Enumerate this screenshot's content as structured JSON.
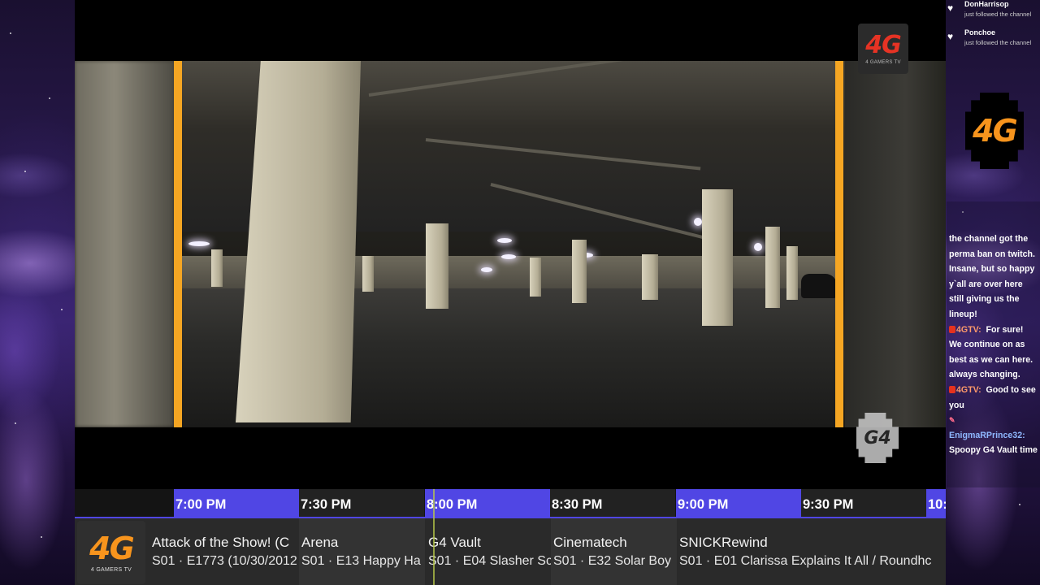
{
  "brand": {
    "mark": "4G",
    "tagline": "4 GAMERS TV",
    "network_bug": "G4",
    "accent_orange": "#f7941d",
    "accent_red": "#e63324",
    "timeline_highlight": "#5046e4"
  },
  "chat": {
    "follows": [
      {
        "name": "DonHarrisop",
        "action": "just followed the channel"
      },
      {
        "name": "Ponchoe",
        "action": "just followed the channel"
      }
    ],
    "messages": [
      {
        "user": "",
        "text": "the channel got the perma ban on twitch. Insane, but so happy y`all are over here still giving us the lineup!"
      },
      {
        "user": "4GTV:",
        "text": "For sure! We continue on as best as we can here. always changing."
      },
      {
        "user": "4GTV:",
        "text": "Good to see you"
      },
      {
        "user": "EnigmaRPrince32:",
        "text": "Spoopy G4 Vault time"
      }
    ]
  },
  "guide": {
    "times": [
      "7:00 PM",
      "7:30 PM",
      "8:00 PM",
      "8:30 PM",
      "9:00 PM",
      "9:30 PM",
      "10:"
    ],
    "programs": [
      {
        "title": "Attack of the Show! (C",
        "episode": "S01 · E1773 (10/30/2012"
      },
      {
        "title": "Arena",
        "episode": "S01 · E13 Happy Ha"
      },
      {
        "title": "G4 Vault",
        "episode": "S01 · E04 Slasher Sc"
      },
      {
        "title": "Cinematech",
        "episode": "S01 · E32 Solar Boy"
      },
      {
        "title": "SNICKRewind",
        "episode": "S01 · E01 Clarissa Explains It All / Roundhc"
      }
    ]
  }
}
